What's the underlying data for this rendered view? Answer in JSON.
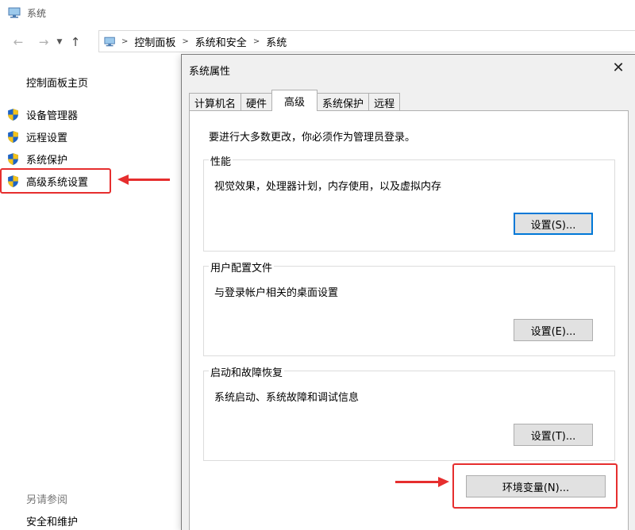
{
  "window": {
    "title": "系统"
  },
  "breadcrumb": [
    "控制面板",
    "系统和安全",
    "系统"
  ],
  "sidebar": {
    "home": "控制面板主页",
    "links": [
      "设备管理器",
      "远程设置",
      "系统保护",
      "高级系统设置"
    ],
    "see_also": "另请参阅",
    "security_link": "安全和维护"
  },
  "dialog": {
    "title": "系统属性",
    "close": "✕",
    "tabs": [
      "计算机名",
      "硬件",
      "高级",
      "系统保护",
      "远程"
    ],
    "active_tab": "高级",
    "admin_note": "要进行大多数更改，你必须作为管理员登录。",
    "groups": {
      "performance": {
        "legend": "性能",
        "desc": "视觉效果，处理器计划，内存使用，以及虚拟内存",
        "button": "设置(S)..."
      },
      "profiles": {
        "legend": "用户配置文件",
        "desc": "与登录帐户相关的桌面设置",
        "button": "设置(E)..."
      },
      "startup": {
        "legend": "启动和故障恢复",
        "desc": "系统启动、系统故障和调试信息",
        "button": "设置(T)..."
      }
    },
    "env_button": "环境变量(N)..."
  },
  "colors": {
    "annotation": "#e62e2e",
    "focus": "#0078d7",
    "shield_blue": "#1e63c4",
    "shield_yellow": "#f2c21b"
  },
  "icons": [
    "computer-icon",
    "back-arrow-icon",
    "forward-arrow-icon",
    "dropdown-chevron-icon",
    "up-arrow-icon",
    "shield-icon",
    "close-icon"
  ]
}
